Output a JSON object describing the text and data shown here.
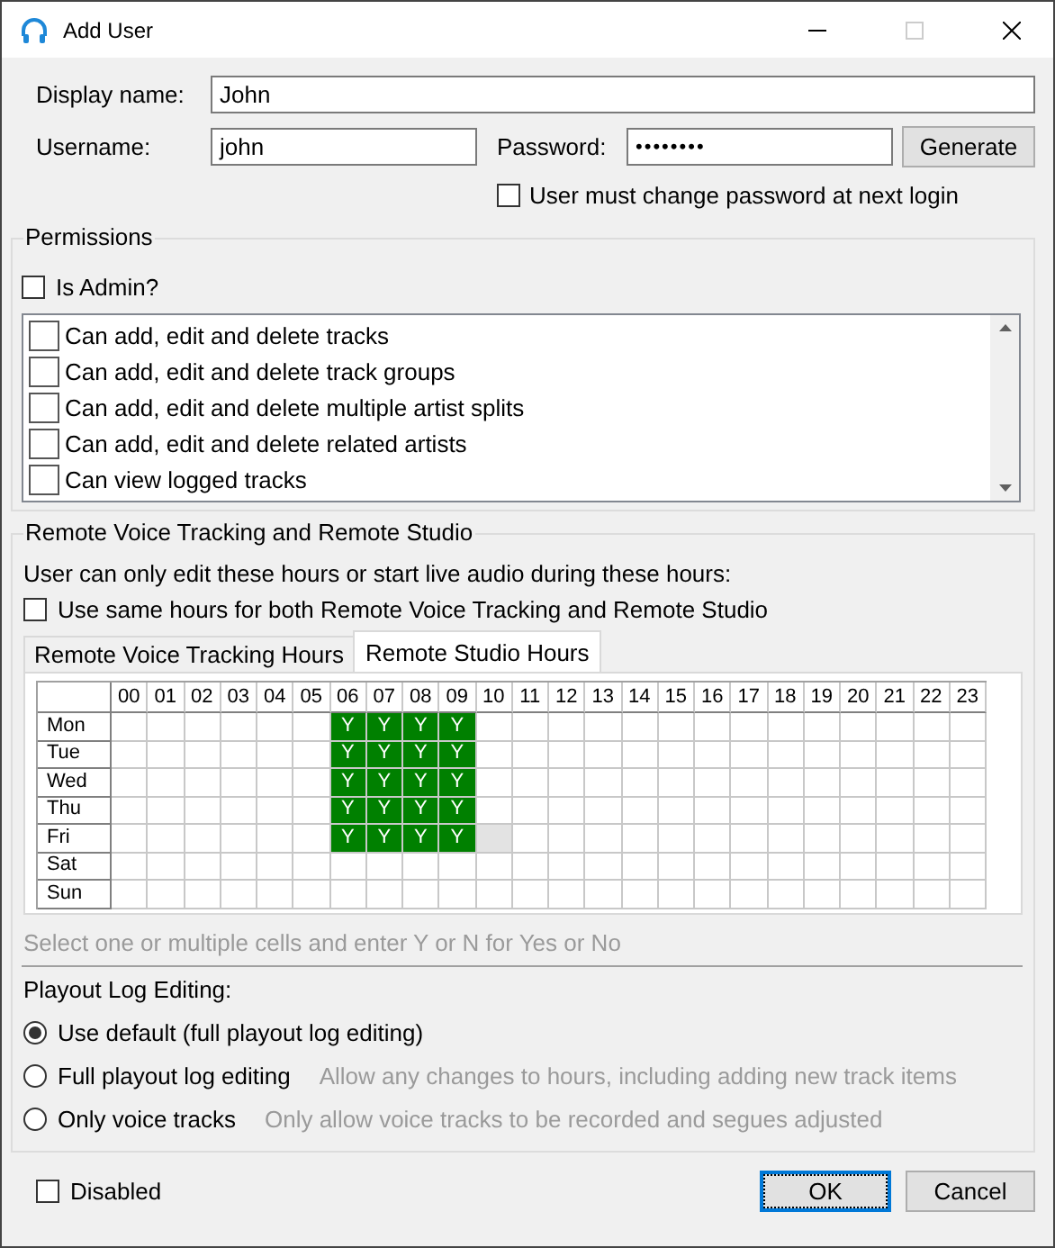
{
  "window": {
    "title": "Add User"
  },
  "display_name": {
    "label": "Display name:",
    "value": "John"
  },
  "username": {
    "label": "Username:",
    "value": "john"
  },
  "password": {
    "label": "Password:",
    "value": "••••••••"
  },
  "generate_button": "Generate",
  "must_change_password": {
    "label": "User must change password at next login",
    "checked": false
  },
  "permissions": {
    "title": "Permissions",
    "is_admin": {
      "label": "Is Admin?",
      "checked": false
    },
    "items": [
      {
        "label": "Can add, edit and delete tracks",
        "checked": false
      },
      {
        "label": "Can add, edit and delete track groups",
        "checked": false
      },
      {
        "label": "Can add, edit and delete multiple artist splits",
        "checked": false
      },
      {
        "label": "Can add, edit and delete related artists",
        "checked": false
      },
      {
        "label": "Can view logged tracks",
        "checked": false
      }
    ]
  },
  "remote": {
    "title": "Remote Voice Tracking and Remote Studio",
    "description": "User can only edit these hours or start live audio during these hours:",
    "same_hours": {
      "label": "Use same hours for both Remote Voice Tracking and Remote Studio",
      "checked": false
    },
    "tabs": [
      {
        "label": "Remote Voice Tracking Hours",
        "selected": false
      },
      {
        "label": "Remote Studio Hours",
        "selected": true
      }
    ],
    "hours": [
      "00",
      "01",
      "02",
      "03",
      "04",
      "05",
      "06",
      "07",
      "08",
      "09",
      "10",
      "11",
      "12",
      "13",
      "14",
      "15",
      "16",
      "17",
      "18",
      "19",
      "20",
      "21",
      "22",
      "23"
    ],
    "rows": [
      {
        "day": "Mon",
        "cells": [
          {
            "selected": false
          },
          {
            "selected": false
          },
          {
            "selected": false
          },
          {
            "selected": false
          },
          {
            "selected": false
          },
          {
            "selected": false
          },
          {
            "value": "Y",
            "selected": false
          },
          {
            "value": "Y",
            "selected": false
          },
          {
            "value": "Y",
            "selected": false
          },
          {
            "value": "Y",
            "selected": false
          },
          {
            "selected": false
          },
          {
            "selected": false
          },
          {
            "selected": false
          },
          {
            "selected": false
          },
          {
            "selected": false
          },
          {
            "selected": false
          },
          {
            "selected": false
          },
          {
            "selected": false
          },
          {
            "selected": false
          },
          {
            "selected": false
          },
          {
            "selected": false
          },
          {
            "selected": false
          },
          {
            "selected": false
          },
          {
            "selected": false
          }
        ]
      },
      {
        "day": "Tue",
        "cells": [
          {
            "selected": false
          },
          {
            "selected": false
          },
          {
            "selected": false
          },
          {
            "selected": false
          },
          {
            "selected": false
          },
          {
            "selected": false
          },
          {
            "value": "Y",
            "selected": false
          },
          {
            "value": "Y",
            "selected": false
          },
          {
            "value": "Y",
            "selected": false
          },
          {
            "value": "Y",
            "selected": false
          },
          {
            "selected": false
          },
          {
            "selected": false
          },
          {
            "selected": false
          },
          {
            "selected": false
          },
          {
            "selected": false
          },
          {
            "selected": false
          },
          {
            "selected": false
          },
          {
            "selected": false
          },
          {
            "selected": false
          },
          {
            "selected": false
          },
          {
            "selected": false
          },
          {
            "selected": false
          },
          {
            "selected": false
          },
          {
            "selected": false
          }
        ]
      },
      {
        "day": "Wed",
        "cells": [
          {
            "selected": false
          },
          {
            "selected": false
          },
          {
            "selected": false
          },
          {
            "selected": false
          },
          {
            "selected": false
          },
          {
            "selected": false
          },
          {
            "value": "Y",
            "selected": false
          },
          {
            "value": "Y",
            "selected": false
          },
          {
            "value": "Y",
            "selected": false
          },
          {
            "value": "Y",
            "selected": false
          },
          {
            "selected": false
          },
          {
            "selected": false
          },
          {
            "selected": false
          },
          {
            "selected": false
          },
          {
            "selected": false
          },
          {
            "selected": false
          },
          {
            "selected": false
          },
          {
            "selected": false
          },
          {
            "selected": false
          },
          {
            "selected": false
          },
          {
            "selected": false
          },
          {
            "selected": false
          },
          {
            "selected": false
          },
          {
            "selected": false
          }
        ]
      },
      {
        "day": "Thu",
        "cells": [
          {
            "selected": false
          },
          {
            "selected": false
          },
          {
            "selected": false
          },
          {
            "selected": false
          },
          {
            "selected": false
          },
          {
            "selected": false
          },
          {
            "value": "Y",
            "selected": false
          },
          {
            "value": "Y",
            "selected": false
          },
          {
            "value": "Y",
            "selected": false
          },
          {
            "value": "Y",
            "selected": false
          },
          {
            "selected": false
          },
          {
            "selected": false
          },
          {
            "selected": false
          },
          {
            "selected": false
          },
          {
            "selected": false
          },
          {
            "selected": false
          },
          {
            "selected": false
          },
          {
            "selected": false
          },
          {
            "selected": false
          },
          {
            "selected": false
          },
          {
            "selected": false
          },
          {
            "selected": false
          },
          {
            "selected": false
          },
          {
            "selected": false
          }
        ]
      },
      {
        "day": "Fri",
        "cells": [
          {
            "selected": false
          },
          {
            "selected": false
          },
          {
            "selected": false
          },
          {
            "selected": false
          },
          {
            "selected": false
          },
          {
            "selected": false
          },
          {
            "value": "Y",
            "selected": false
          },
          {
            "value": "Y",
            "selected": false
          },
          {
            "value": "Y",
            "selected": false
          },
          {
            "value": "Y",
            "selected": false
          },
          {
            "selected": true
          },
          {
            "selected": false
          },
          {
            "selected": false
          },
          {
            "selected": false
          },
          {
            "selected": false
          },
          {
            "selected": false
          },
          {
            "selected": false
          },
          {
            "selected": false
          },
          {
            "selected": false
          },
          {
            "selected": false
          },
          {
            "selected": false
          },
          {
            "selected": false
          },
          {
            "selected": false
          },
          {
            "selected": false
          }
        ]
      },
      {
        "day": "Sat",
        "cells": [
          {
            "selected": false
          },
          {
            "selected": false
          },
          {
            "selected": false
          },
          {
            "selected": false
          },
          {
            "selected": false
          },
          {
            "selected": false
          },
          {
            "selected": false
          },
          {
            "selected": false
          },
          {
            "selected": false
          },
          {
            "selected": false
          },
          {
            "selected": false
          },
          {
            "selected": false
          },
          {
            "selected": false
          },
          {
            "selected": false
          },
          {
            "selected": false
          },
          {
            "selected": false
          },
          {
            "selected": false
          },
          {
            "selected": false
          },
          {
            "selected": false
          },
          {
            "selected": false
          },
          {
            "selected": false
          },
          {
            "selected": false
          },
          {
            "selected": false
          },
          {
            "selected": false
          }
        ]
      },
      {
        "day": "Sun",
        "cells": [
          {
            "selected": false
          },
          {
            "selected": false
          },
          {
            "selected": false
          },
          {
            "selected": false
          },
          {
            "selected": false
          },
          {
            "selected": false
          },
          {
            "selected": false
          },
          {
            "selected": false
          },
          {
            "selected": false
          },
          {
            "selected": false
          },
          {
            "selected": false
          },
          {
            "selected": false
          },
          {
            "selected": false
          },
          {
            "selected": false
          },
          {
            "selected": false
          },
          {
            "selected": false
          },
          {
            "selected": false
          },
          {
            "selected": false
          },
          {
            "selected": false
          },
          {
            "selected": false
          },
          {
            "selected": false
          },
          {
            "selected": false
          },
          {
            "selected": false
          },
          {
            "selected": false
          }
        ]
      }
    ],
    "hint": "Select one or multiple cells and enter Y or N for Yes or No"
  },
  "playout": {
    "title": "Playout Log Editing:",
    "options": [
      {
        "label": "Use default (full playout log editing)",
        "selected": true
      },
      {
        "label": "Full playout log editing",
        "description": "Allow any changes to hours, including adding new track items",
        "selected": false
      },
      {
        "label": "Only voice tracks",
        "description": "Only allow voice tracks to be recorded and segues adjusted",
        "selected": false
      }
    ]
  },
  "disabled": {
    "label": "Disabled",
    "checked": false
  },
  "buttons": [
    {
      "label": "OK",
      "default": true
    },
    {
      "label": "Cancel",
      "default": false
    }
  ]
}
